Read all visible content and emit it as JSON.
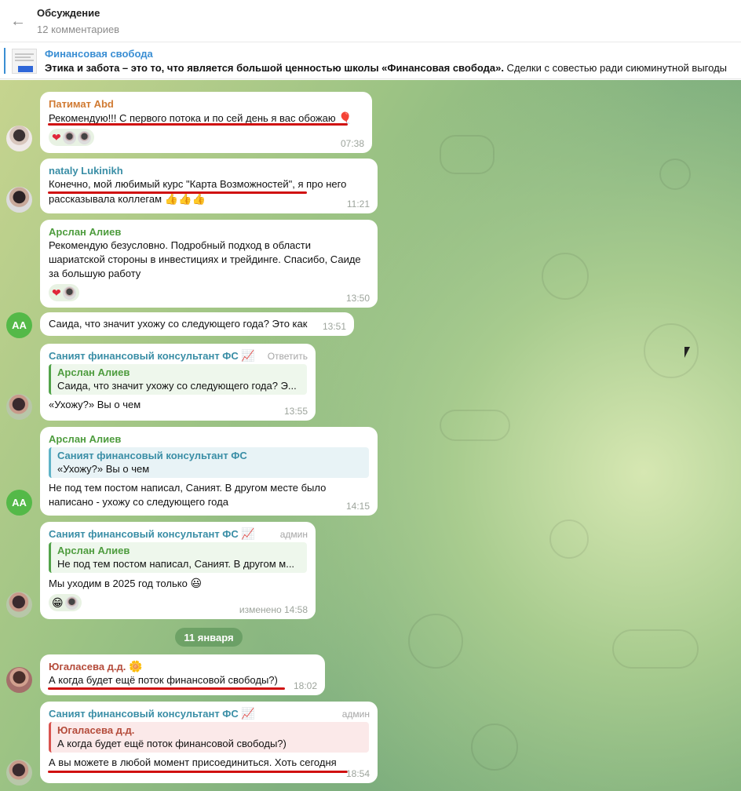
{
  "header": {
    "back_icon": "←",
    "title": "Обсуждение",
    "subtitle": "12 комментариев"
  },
  "pinned": {
    "channel": "Финансовая свобода",
    "text_bold": "Этика и забота – это то, что является большой ценностью школы «Финансовая свобода».",
    "text_rest": "  Сделки с совестью ради сиюминутной выгоды"
  },
  "messages": [
    {
      "author": "Патимат Abd",
      "text": "Рекомендую!!! С первого потока и по сей день я вас обожаю",
      "emoji": "🎈",
      "time": "07:38",
      "reaction": "❤"
    },
    {
      "author": "nataly Lukinikh",
      "text_underlined": "Конечно, мой любимый курс \"Карта Возможностей\"",
      "text_rest": ", я про него рассказывала коллегам",
      "emoji": "👍👍👍",
      "time": "11:21"
    },
    {
      "author": "Арслан Алиев",
      "text": "Рекомендую безусловно. Подробный подход в области шариатской стороны в инвестициях и трейдинге. Спасибо, Саиде за большую работу",
      "time": "13:50",
      "reaction": "❤"
    },
    {
      "avatar": "AA",
      "text": "Саида, что значит ухожу со следующего года? Это как",
      "time": "13:51"
    },
    {
      "author": "Саният финансовый консультант ФС",
      "author_emoji": "📈",
      "tag": "Ответить",
      "reply_author": "Арслан Алиев",
      "reply_text": "Саида, что значит ухожу со следующего года? Э...",
      "text": "«Ухожу?» Вы о чем",
      "time": "13:55"
    },
    {
      "author": "Арслан Алиев",
      "avatar": "AA",
      "reply_author": "Саният финансовый консультант ФС",
      "reply_text": "«Ухожу?» Вы о чем",
      "text": "Не под тем постом написал, Саният. В другом месте было написано - ухожу со следующего года",
      "time": "14:15"
    },
    {
      "author": "Саният финансовый консультант ФС",
      "author_emoji": "📈",
      "tag": "админ",
      "reply_author": "Арслан Алиев",
      "reply_text": "Не под тем постом написал, Саният. В другом м...",
      "text": "Мы уходим в 2025 год только",
      "emoji": "😃",
      "time": "изменено 14:58",
      "reaction": "😁"
    },
    {
      "author": "Югаласева д.д.",
      "author_emoji": "🌼",
      "text": "А когда будет ещё поток финансовой свободы?)",
      "time": "18:02"
    },
    {
      "author": "Саният финансовый консультант ФС",
      "author_emoji": "📈",
      "tag": "админ",
      "reply_author": "Югаласева д.д.",
      "reply_text": "А когда будет ещё поток финансовой свободы?)",
      "text": "А вы можете в любой момент присоединиться. Хоть сегодня",
      "time": "18:54"
    }
  ],
  "date_separator": "11 января"
}
